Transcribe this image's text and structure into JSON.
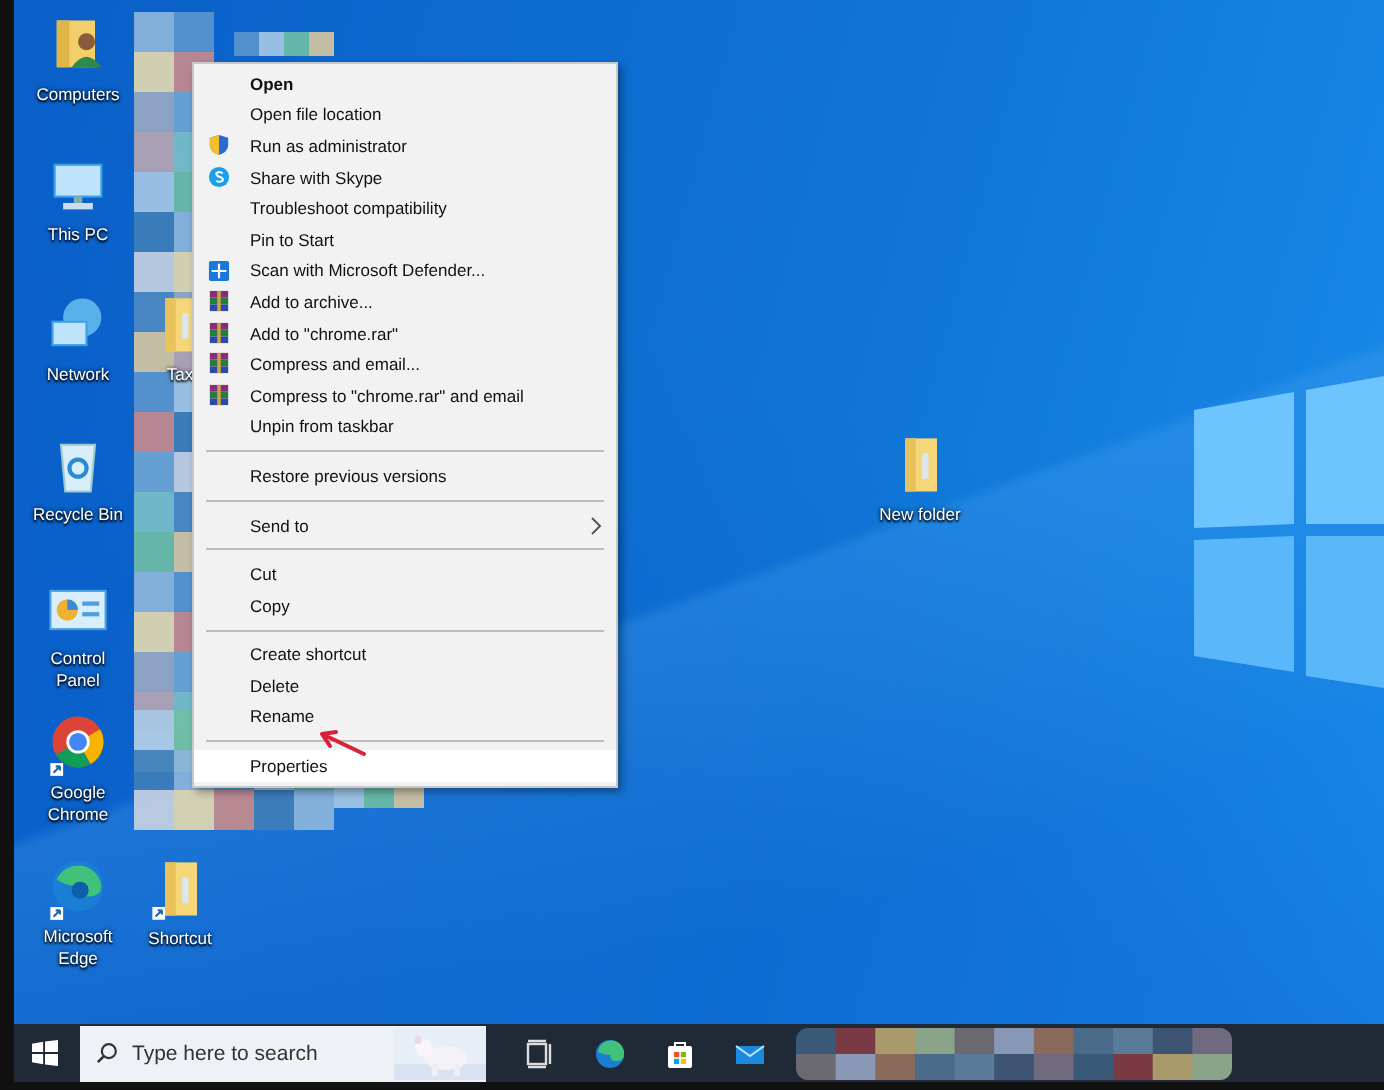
{
  "desktop": {
    "column_1": [
      {
        "label": "Computers",
        "kind": "user-folder"
      },
      {
        "label": "This PC",
        "kind": "pc"
      },
      {
        "label": "Network",
        "kind": "network"
      },
      {
        "label": "Recycle Bin",
        "kind": "recycle"
      },
      {
        "label": "Control Panel",
        "kind": "control-panel"
      },
      {
        "label": "Google Chrome",
        "kind": "chrome"
      },
      {
        "label": "Microsoft Edge",
        "kind": "edge"
      }
    ],
    "column_2": [
      {
        "label": "Tax",
        "kind": "folder"
      },
      {
        "label": "Shortcut",
        "kind": "shortcut-folder"
      }
    ],
    "free": [
      {
        "label": "New folder",
        "kind": "folder"
      }
    ]
  },
  "context_menu": {
    "items": [
      {
        "kind": "item",
        "label": "Open",
        "bold": true,
        "highlighted": false
      },
      {
        "kind": "item",
        "label": "Open file location",
        "bold": false,
        "highlighted": false
      },
      {
        "kind": "item",
        "label": "Run as administrator",
        "bold": false,
        "highlighted": false
      },
      {
        "kind": "item",
        "label": "Share with Skype",
        "bold": false,
        "highlighted": false
      },
      {
        "kind": "item",
        "label": "Troubleshoot compatibility",
        "bold": false,
        "highlighted": false
      },
      {
        "kind": "item",
        "label": "Pin to Start",
        "bold": false,
        "highlighted": false
      },
      {
        "kind": "item",
        "label": "Scan with Microsoft Defender...",
        "bold": false,
        "highlighted": false
      },
      {
        "kind": "item",
        "label": "Add to archive...",
        "bold": false,
        "highlighted": false
      },
      {
        "kind": "item",
        "label": "Add to \"chrome.rar\"",
        "bold": false,
        "highlighted": false
      },
      {
        "kind": "item",
        "label": "Compress and email...",
        "bold": false,
        "highlighted": false
      },
      {
        "kind": "item",
        "label": "Compress to \"chrome.rar\" and email",
        "bold": false,
        "highlighted": false
      },
      {
        "kind": "item",
        "label": "Unpin from taskbar",
        "bold": false,
        "highlighted": false
      },
      {
        "kind": "separator"
      },
      {
        "kind": "item",
        "label": "Restore previous versions",
        "bold": false,
        "highlighted": false
      },
      {
        "kind": "separator"
      },
      {
        "kind": "submenu",
        "label": "Send to",
        "bold": false,
        "highlighted": false
      },
      {
        "kind": "separator"
      },
      {
        "kind": "item",
        "label": "Cut",
        "bold": false,
        "highlighted": false
      },
      {
        "kind": "item",
        "label": "Copy",
        "bold": false,
        "highlighted": false
      },
      {
        "kind": "separator"
      },
      {
        "kind": "item",
        "label": "Create shortcut",
        "bold": false,
        "highlighted": false
      },
      {
        "kind": "item",
        "label": "Delete",
        "bold": false,
        "highlighted": false
      },
      {
        "kind": "item",
        "label": "Rename",
        "bold": false,
        "highlighted": false
      },
      {
        "kind": "separator"
      },
      {
        "kind": "item",
        "label": "Properties",
        "bold": false,
        "highlighted": true
      }
    ]
  },
  "taskbar": {
    "search": {
      "placeholder": "Type here to search"
    },
    "pinned": [
      {
        "kind": "task-view"
      },
      {
        "kind": "edge"
      },
      {
        "kind": "store"
      },
      {
        "kind": "mail"
      }
    ]
  }
}
